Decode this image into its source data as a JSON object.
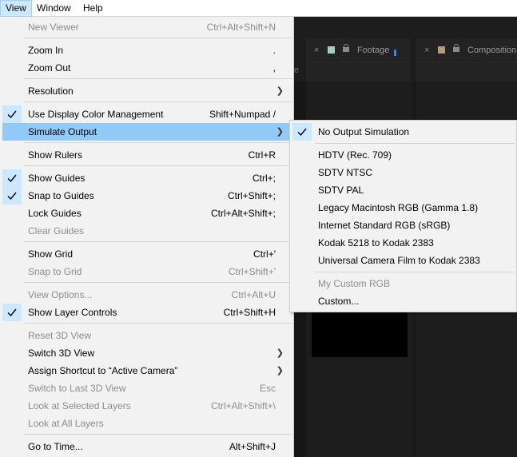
{
  "menubar": [
    "View",
    "Window",
    "Help"
  ],
  "panels": [
    {
      "name": "Footage",
      "swatch": "#a3cfc0"
    },
    {
      "name": "Composition",
      "swatch": "#b19c7e"
    }
  ],
  "background_letter": "e",
  "view_menu": [
    {
      "label": "New Viewer",
      "shortcut": "Ctrl+Alt+Shift+N",
      "disabled": true
    },
    {
      "label": "Zoom In",
      "shortcut": "."
    },
    {
      "label": "Zoom Out",
      "shortcut": ","
    },
    {
      "label": "Resolution",
      "submenu": true
    },
    {
      "label": "Use Display Color Management",
      "shortcut": "Shift+Numpad /",
      "checked": true
    },
    {
      "label": "Simulate Output",
      "submenu": true,
      "highlighted": true
    },
    {
      "label": "Show Rulers",
      "shortcut": "Ctrl+R"
    },
    {
      "label": "Show Guides",
      "shortcut": "Ctrl+;",
      "checked": true
    },
    {
      "label": "Snap to Guides",
      "shortcut": "Ctrl+Shift+;",
      "checked": true
    },
    {
      "label": "Lock Guides",
      "shortcut": "Ctrl+Alt+Shift+;"
    },
    {
      "label": "Clear Guides",
      "disabled": true
    },
    {
      "label": "Show Grid",
      "shortcut": "Ctrl+'"
    },
    {
      "label": "Snap to Grid",
      "shortcut": "Ctrl+Shift+'",
      "disabled": true
    },
    {
      "label": "View Options...",
      "shortcut": "Ctrl+Alt+U",
      "disabled": true
    },
    {
      "label": "Show Layer Controls",
      "shortcut": "Ctrl+Shift+H",
      "checked": true
    },
    {
      "label": "Reset 3D View",
      "disabled": true
    },
    {
      "label": "Switch 3D View",
      "submenu": true
    },
    {
      "label": "Assign Shortcut to “Active Camera”",
      "submenu": true
    },
    {
      "label": "Switch to Last 3D View",
      "shortcut": "Esc",
      "disabled": true
    },
    {
      "label": "Look at Selected Layers",
      "shortcut": "Ctrl+Alt+Shift+\\",
      "disabled": true
    },
    {
      "label": "Look at All Layers",
      "disabled": true
    },
    {
      "label": "Go to Time...",
      "shortcut": "Alt+Shift+J"
    }
  ],
  "simulate_output_menu": [
    {
      "label": "No Output Simulation",
      "checked": true
    },
    {
      "label": "HDTV (Rec. 709)"
    },
    {
      "label": "SDTV NTSC"
    },
    {
      "label": "SDTV PAL"
    },
    {
      "label": "Legacy Macintosh RGB (Gamma 1.8)"
    },
    {
      "label": "Internet Standard RGB (sRGB)"
    },
    {
      "label": "Kodak 5218 to Kodak 2383"
    },
    {
      "label": "Universal Camera Film to Kodak 2383"
    },
    {
      "label": "My Custom RGB",
      "disabled": true
    },
    {
      "label": "Custom..."
    }
  ]
}
